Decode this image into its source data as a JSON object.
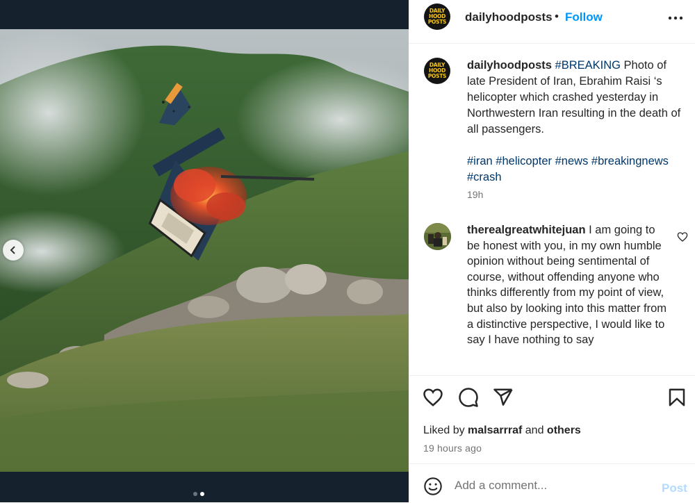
{
  "post": {
    "username": "dailyhoodposts",
    "separator": "•",
    "follow_label": "Follow",
    "logo_lines": [
      "DAILY",
      "HOOD",
      "POSTS"
    ],
    "media": {
      "carousel_count": 2,
      "active_index": 1
    }
  },
  "caption": {
    "username": "dailyhoodposts",
    "hashtag_first": "#BREAKING",
    "text": " Photo of late President of Iran, Ebrahim Raisi ‘s helicopter which crashed yesterday in Northwestern Iran resulting in the death of all passengers.",
    "hashtags": [
      "#iran",
      "#helicopter",
      "#news",
      "#breakingnews",
      "#crash"
    ],
    "time": "19h"
  },
  "comment": {
    "username": "therealgreatwhitejuan",
    "text": " I am going to be honest with you, in my own humble opinion without being sentimental of course, without offending anyone who thinks differently from my point of view, but also by looking into this matter from a distinctive perspective, I would like to say I have nothing to say"
  },
  "likes": {
    "prefix": "Liked by ",
    "user": "malsarrraf",
    "middle": " and ",
    "others": "others",
    "time": "19 hours ago"
  },
  "add_comment": {
    "placeholder": "Add a comment...",
    "post_label": "Post"
  },
  "colors": {
    "accent": "#0095f6",
    "hashtag": "#00376b",
    "muted": "#737373",
    "post_disabled": "#b3dbff",
    "media_bg": "#16212e"
  },
  "icons": [
    "chevron-left-icon",
    "more-horizontal-icon",
    "heart-icon",
    "comment-icon",
    "share-icon",
    "bookmark-icon",
    "emoji-icon"
  ]
}
